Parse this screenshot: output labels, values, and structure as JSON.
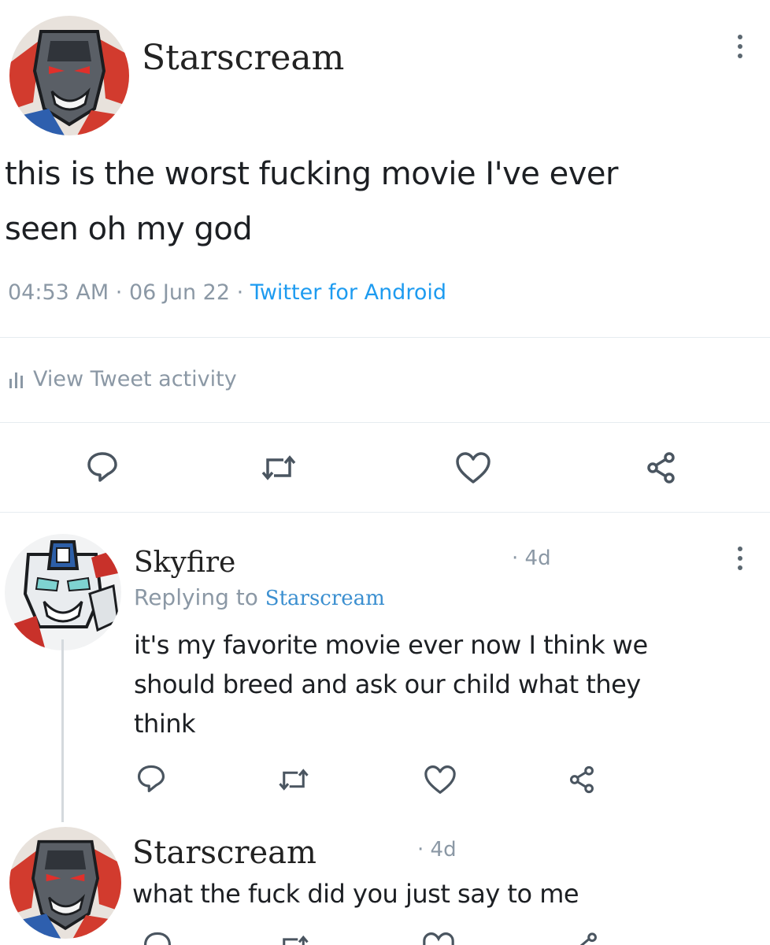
{
  "tweet": {
    "author_name": "Starscream",
    "text_line1": "this is the worst fucking movie I've ever",
    "text_line2": "seen oh my god",
    "time": "04:53 AM",
    "date": "06 Jun 22",
    "source": "Twitter for Android",
    "separator": "·",
    "activity_label": "View Tweet activity"
  },
  "replies": [
    {
      "author_name": "Skyfire",
      "age": "4d",
      "replying_label": "Replying to",
      "replying_handle": "Starscream",
      "text_line1": "it's my favorite movie ever now I think we",
      "text_line2": "should breed and ask our child what they",
      "text_line3": "think"
    },
    {
      "author_name": "Starscream",
      "age": "4d",
      "text_line1": "what the fuck did you just say to me"
    }
  ],
  "colors": {
    "link": "#1d9bf0",
    "muted": "#8b98a5",
    "starscream_red": "#d23b2e",
    "skyfire_blue": "#2d5fa8"
  },
  "icons": [
    "more-vertical-icon",
    "reply-icon",
    "retweet-icon",
    "like-icon",
    "share-icon",
    "activity-bars-icon"
  ]
}
